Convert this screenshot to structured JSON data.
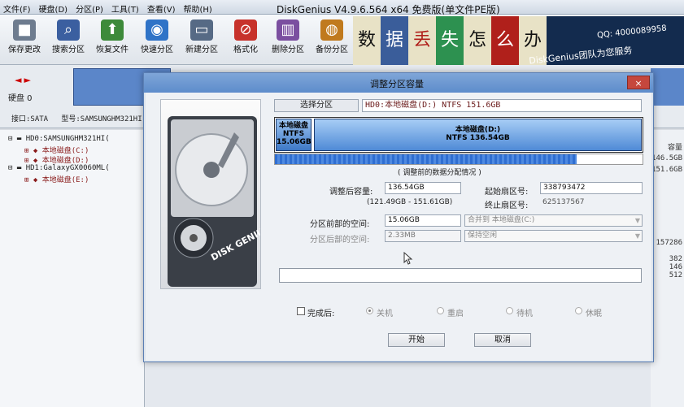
{
  "app": {
    "title": "DiskGenius V4.9.6.564 x64 免费版(单文件PE版)",
    "menu": [
      "文件(F)",
      "硬盘(D)",
      "分区(P)",
      "工具(T)",
      "查看(V)",
      "帮助(H)"
    ]
  },
  "toolbar": {
    "items": [
      {
        "label": "保存更改",
        "icon": "save-icon",
        "color": "#6e7c8f"
      },
      {
        "label": "搜索分区",
        "icon": "search-icon",
        "color": "#3b5fa0"
      },
      {
        "label": "恢复文件",
        "icon": "recover-icon",
        "color": "#3d8a3a"
      },
      {
        "label": "快速分区",
        "icon": "quick-partition-icon",
        "color": "#2f73c7"
      },
      {
        "label": "新建分区",
        "icon": "new-partition-icon",
        "color": "#566a85"
      },
      {
        "label": "格式化",
        "icon": "format-icon",
        "color": "#c7322b"
      },
      {
        "label": "删除分区",
        "icon": "delete-partition-icon",
        "color": "#7b4fa0"
      },
      {
        "label": "备份分区",
        "icon": "backup-icon",
        "color": "#c07a1e"
      }
    ]
  },
  "banner": {
    "tiles": [
      "数",
      "据",
      "丢",
      "失",
      "怎",
      "么",
      "办"
    ],
    "slogan": "DiskGenius团队为您服务",
    "phone": "QQ: 4000089958"
  },
  "disk_panel": {
    "label": "硬盘 0",
    "interface": "接口:SATA",
    "model": "型号:SAMSUNGHM321HI"
  },
  "tree": [
    {
      "text": "HD0:SAMSUNGHM321HI(",
      "type": "disk"
    },
    {
      "text": "本地磁盘(C:)",
      "type": "part"
    },
    {
      "text": "本地磁盘(D:)",
      "type": "part"
    },
    {
      "text": "HD1:GalaxyGX0060ML(",
      "type": "disk"
    },
    {
      "text": "本地磁盘(E:)",
      "type": "part"
    }
  ],
  "right_panel": {
    "header": "容量",
    "values": [
      "146.5GB",
      "151.6GB",
      "157286",
      "382",
      "146",
      "512"
    ]
  },
  "dialog": {
    "title": "调整分区容量",
    "close": "×",
    "select_partition_btn": "选择分区",
    "partition_label": "HD0:本地磁盘(D:) NTFS 151.6GB",
    "bar": {
      "seg1_name": "本地磁盘",
      "seg1_fs": "NTFS",
      "seg1_size": "15.06GB",
      "seg2_name": "本地磁盘(D:)",
      "seg2_detail": "NTFS 136.54GB",
      "seg1_size_gb": 15.06,
      "seg2_size_gb": 136.54,
      "used_fraction": 0.82
    },
    "dist_caption": "( 调整前的数据分配情况 )",
    "after_size_label": "调整后容量:",
    "after_size_value": "136.54GB",
    "size_formula": "(121.49GB - 151.61GB)",
    "start_sector_label": "起始扇区号:",
    "start_sector_value": "338793472",
    "end_sector_label": "终止扇区号:",
    "end_sector_value": "625137567",
    "front_space_label": "分区前部的空间:",
    "front_space_value": "15.06GB",
    "front_action": "合并到 本地磁盘(C:)",
    "back_space_label": "分区后部的空间:",
    "back_space_value": "2.33MB",
    "back_action": "保持空闲",
    "after_done_label": "完成后:",
    "options": [
      "关机",
      "重启",
      "待机",
      "休眠"
    ],
    "start_btn": "开始",
    "cancel_btn": "取消",
    "hdd_brand": "DISK GENIUS"
  }
}
